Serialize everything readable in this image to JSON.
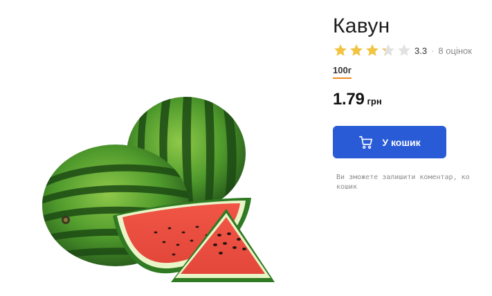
{
  "product": {
    "title": "Кавун",
    "image_alt": "watermelon",
    "rating": {
      "value": "3.3",
      "stars": 3.3,
      "max_stars": 5,
      "separator": "·",
      "count_label": "8 оцінок"
    },
    "weight_option": "100г",
    "price": {
      "value": "1.79",
      "currency": "грн"
    },
    "add_to_cart_label": "У кошик",
    "comment_note_line1": "Ви зможете залишити коментар, ко",
    "comment_note_line2": "кошик"
  },
  "colors": {
    "accent_blue": "#2a5bd7",
    "star_filled": "#f2c440",
    "star_empty": "#e2e2e2",
    "weight_underline": "#f08a24"
  },
  "icons": {
    "cart": "cart-icon",
    "star": "star-icon"
  }
}
